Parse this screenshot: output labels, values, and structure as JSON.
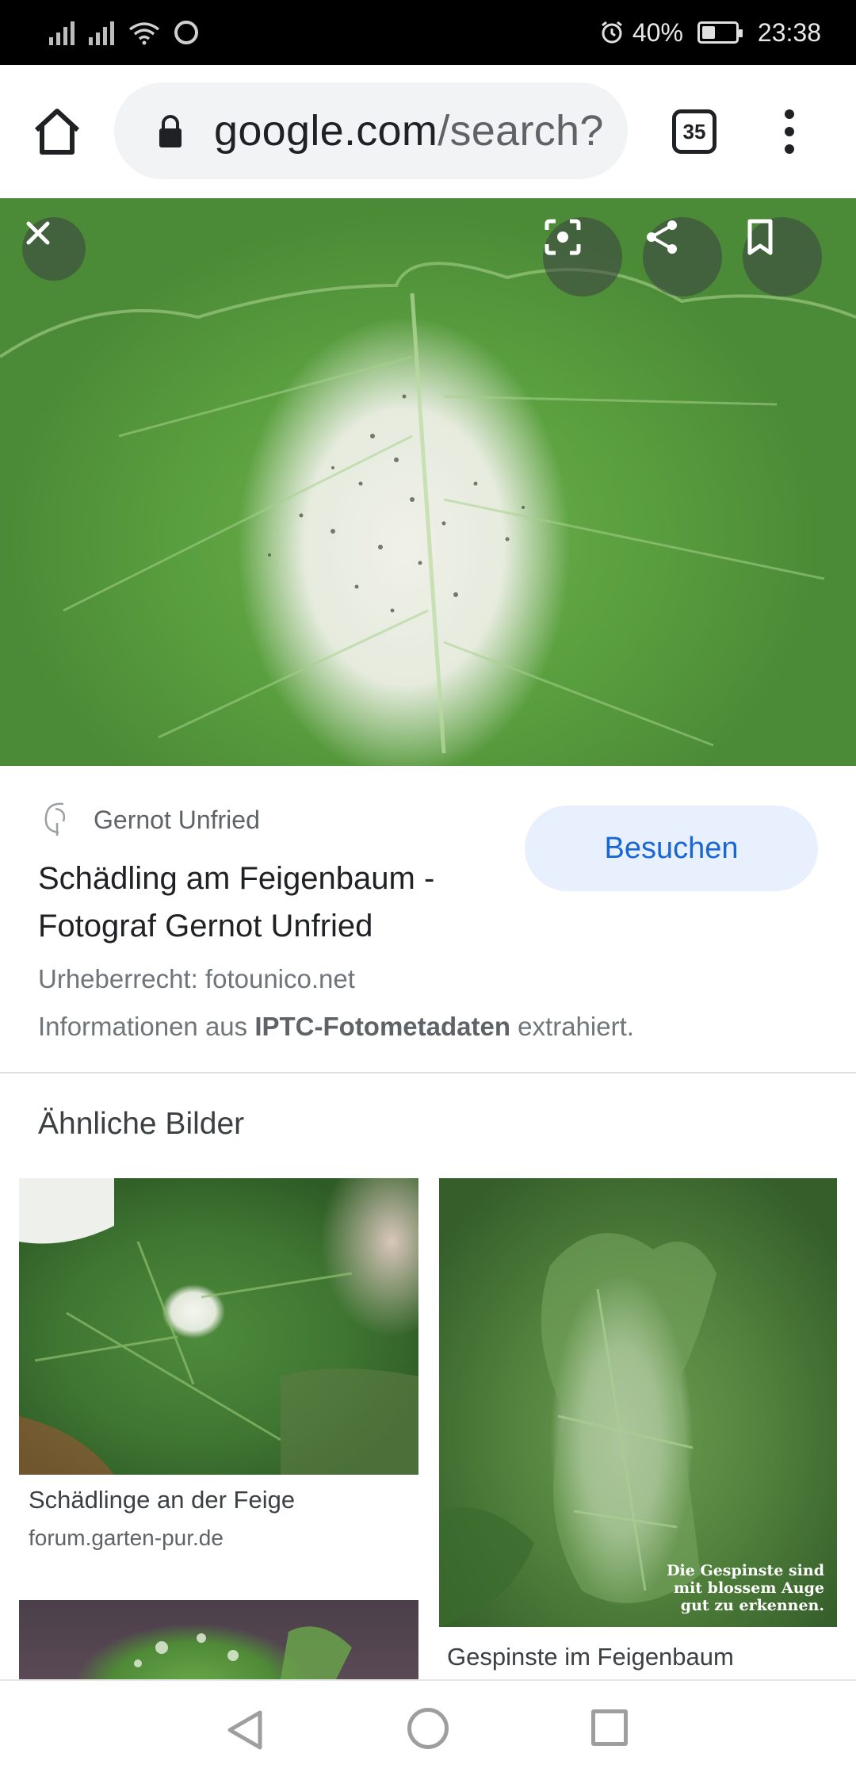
{
  "status_bar": {
    "battery": "40%",
    "time": "23:38"
  },
  "browser": {
    "url_host": "google.com",
    "url_path": "/search?",
    "tab_count": "35"
  },
  "result": {
    "source_name": "Gernot Unfried",
    "title": "Schädling am Feigenbaum - Fotograf Gernot Unfried",
    "visit_label": "Besuchen",
    "copyright": "Urheberrecht: fotounico.net",
    "meta_prefix": "Informationen aus ",
    "meta_bold": "IPTC-Fotometadaten",
    "meta_suffix": " extrahiert."
  },
  "similar": {
    "heading": "Ähnliche Bilder",
    "items": [
      {
        "caption": "Schädlinge an der Feige",
        "domain": "forum.garten-pur.de"
      },
      {
        "caption": "Gespinste im Feigenbaum",
        "overlay_lines": [
          "Die Gespinste sind",
          "mit blossem Auge",
          "gut zu erkennen."
        ]
      }
    ]
  },
  "colors": {
    "accent": "#1967d2",
    "visit_button_bg": "#e8f0fe"
  }
}
